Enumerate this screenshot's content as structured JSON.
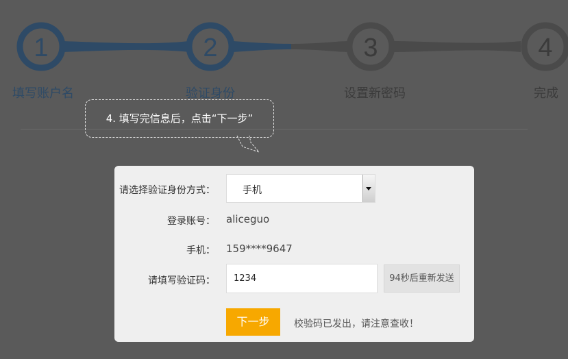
{
  "steps": [
    {
      "number": "1",
      "label": "填写账户名",
      "state": "done"
    },
    {
      "number": "2",
      "label": "验证身份",
      "state": "current"
    },
    {
      "number": "3",
      "label": "设置新密码",
      "state": "pending"
    },
    {
      "number": "4",
      "label": "完成",
      "state": "pending"
    }
  ],
  "tooltip": {
    "text": "4. 填写完信息后，点击“下一步”"
  },
  "form": {
    "method_label": "请选择验证身份方式：",
    "method_value": "手机",
    "account_label": "登录账号：",
    "account_value": "aliceguo",
    "phone_label": "手机：",
    "phone_value": "159****9647",
    "code_label": "请填写验证码：",
    "code_value": "1234",
    "resend_label": "94秒后重新发送",
    "next_label": "下一步",
    "hint": "校验码已发出，请注意查收！"
  },
  "colors": {
    "overlay": "#5a5a5a",
    "active_step": "#2e4a66",
    "inactive_step": "#4a4a4a",
    "primary_button": "#f7a800"
  }
}
